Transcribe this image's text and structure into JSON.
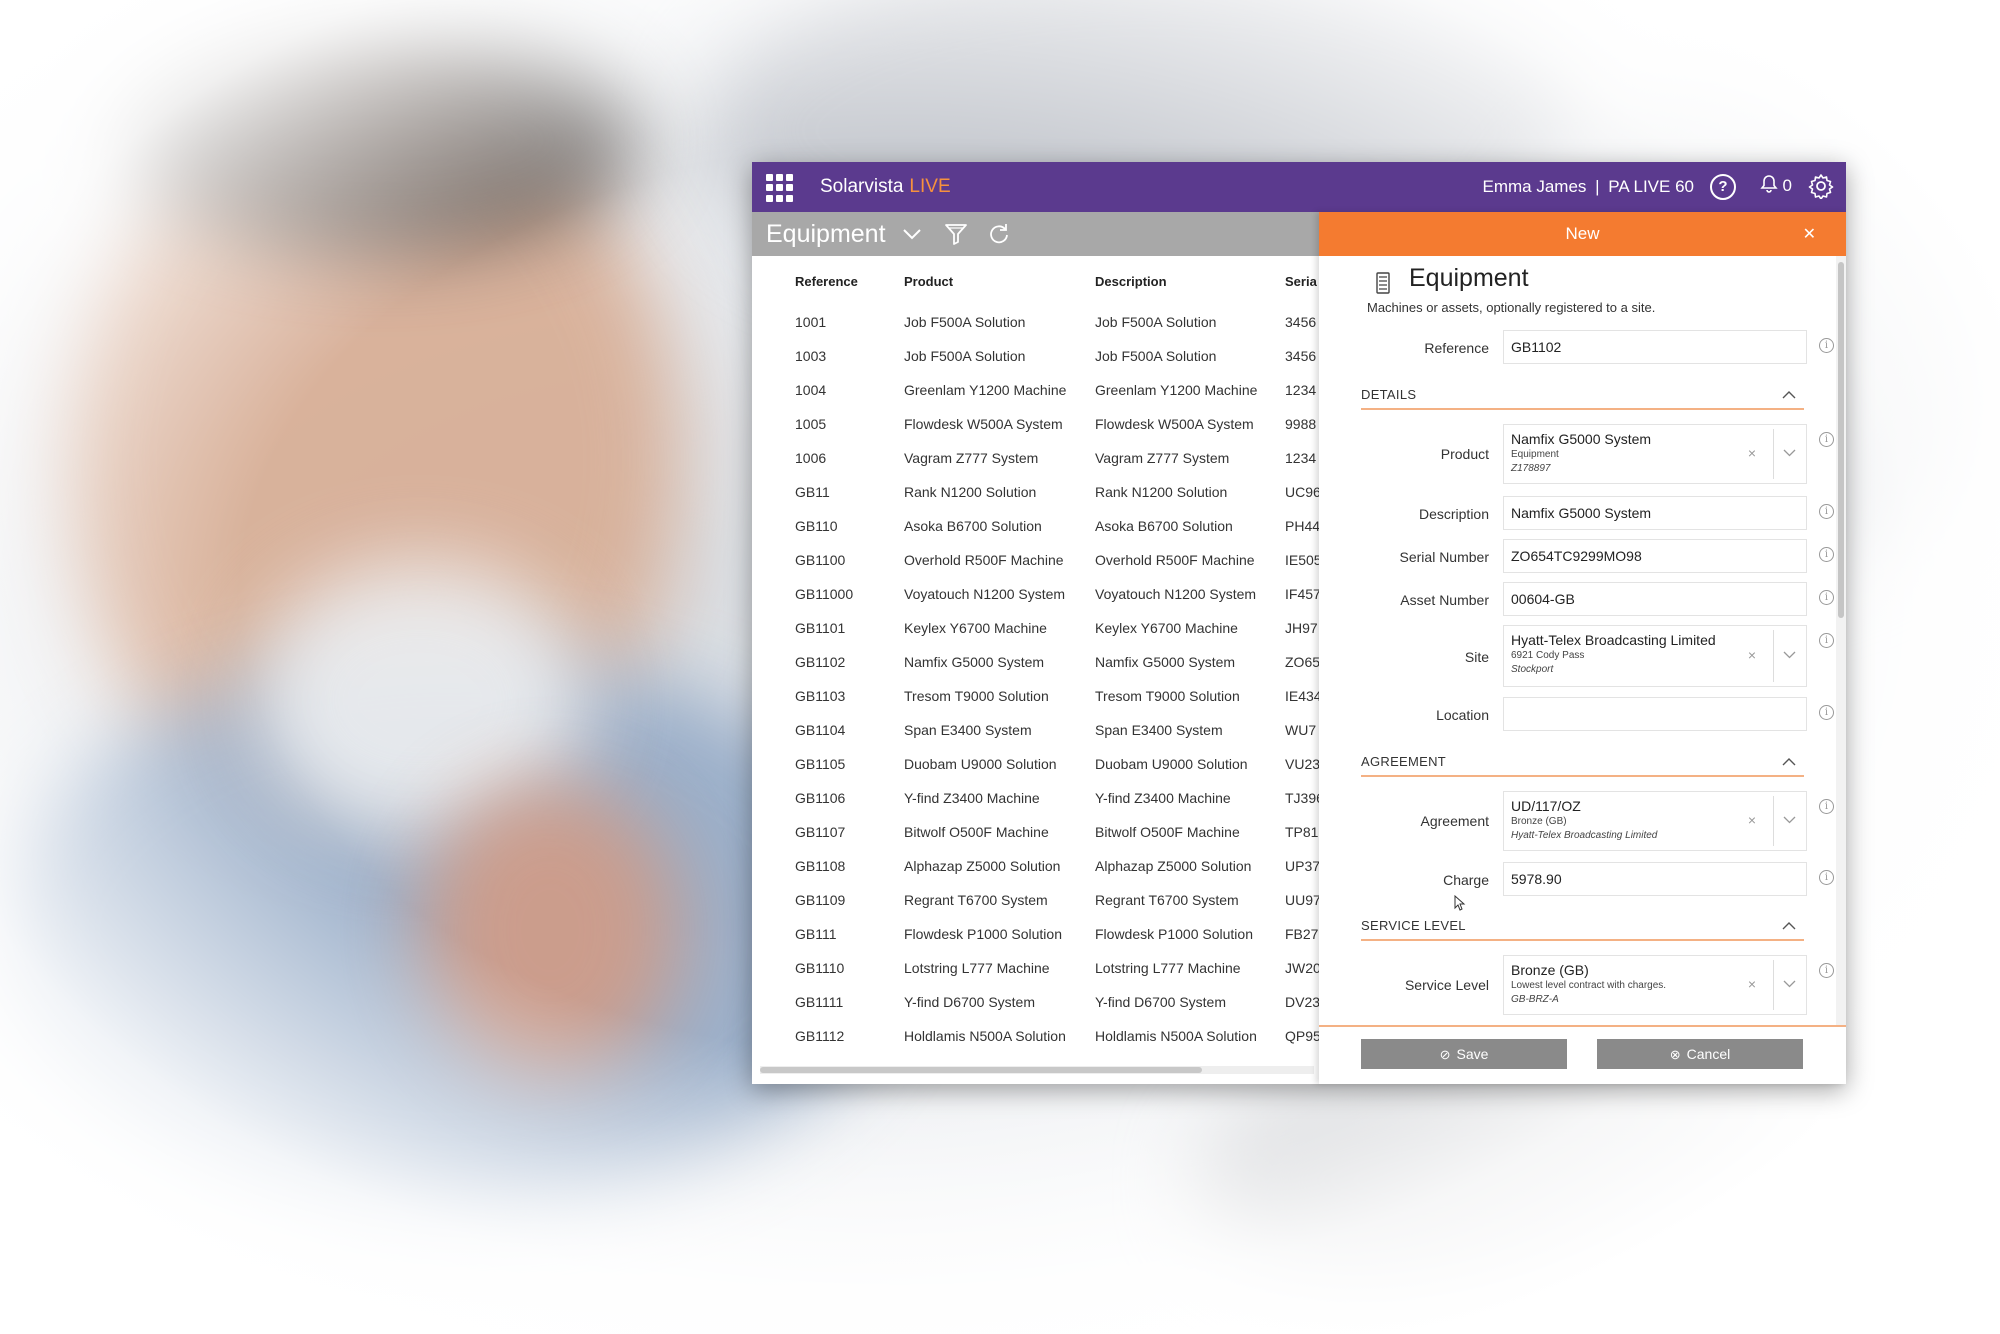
{
  "header": {
    "brand": "Solarvista",
    "brand_suffix": "LIVE",
    "user": "Emma James",
    "separator": "|",
    "environment": "PA LIVE 60",
    "notifications_count": "0"
  },
  "list": {
    "title": "Equipment",
    "columns": [
      "Reference",
      "Product",
      "Description",
      "Seria"
    ],
    "rows": [
      [
        "1001",
        "Job F500A Solution",
        "Job F500A Solution",
        "3456"
      ],
      [
        "1003",
        "Job F500A Solution",
        "Job F500A Solution",
        "3456"
      ],
      [
        "1004",
        "Greenlam Y1200 Machine",
        "Greenlam Y1200 Machine",
        "1234"
      ],
      [
        "1005",
        "Flowdesk W500A System",
        "Flowdesk W500A System",
        "9988"
      ],
      [
        "1006",
        "Vagram Z777 System",
        "Vagram Z777 System",
        "1234"
      ],
      [
        "GB11",
        "Rank N1200 Solution",
        "Rank N1200 Solution",
        "UC96"
      ],
      [
        "GB110",
        "Asoka B6700 Solution",
        "Asoka B6700 Solution",
        "PH44"
      ],
      [
        "GB1100",
        "Overhold R500F Machine",
        "Overhold R500F Machine",
        "IE505"
      ],
      [
        "GB11000",
        "Voyatouch N1200 System",
        "Voyatouch N1200 System",
        "IF457"
      ],
      [
        "GB1101",
        "Keylex Y6700 Machine",
        "Keylex Y6700 Machine",
        "JH97"
      ],
      [
        "GB1102",
        "Namfix G5000 System",
        "Namfix G5000 System",
        "ZO65"
      ],
      [
        "GB1103",
        "Tresom T9000 Solution",
        "Tresom T9000 Solution",
        "IE434"
      ],
      [
        "GB1104",
        "Span E3400 System",
        "Span E3400 System",
        "WU7"
      ],
      [
        "GB1105",
        "Duobam U9000 Solution",
        "Duobam U9000 Solution",
        "VU23"
      ],
      [
        "GB1106",
        "Y-find Z3400 Machine",
        "Y-find Z3400 Machine",
        "TJ396"
      ],
      [
        "GB1107",
        "Bitwolf O500F Machine",
        "Bitwolf O500F Machine",
        "TP81"
      ],
      [
        "GB1108",
        "Alphazap Z5000 Solution",
        "Alphazap Z5000 Solution",
        "UP37"
      ],
      [
        "GB1109",
        "Regrant T6700 System",
        "Regrant T6700 System",
        "UU97"
      ],
      [
        "GB111",
        "Flowdesk P1000 Solution",
        "Flowdesk P1000 Solution",
        "FB27"
      ],
      [
        "GB1110",
        "Lotstring L777 Machine",
        "Lotstring L777 Machine",
        "JW20"
      ],
      [
        "GB1111",
        "Y-find D6700 System",
        "Y-find D6700 System",
        "DV23"
      ],
      [
        "GB1112",
        "Holdlamis N500A Solution",
        "Holdlamis N500A Solution",
        "QP95"
      ]
    ]
  },
  "panel": {
    "header": "New",
    "title": "Equipment",
    "subtitle": "Machines or assets, optionally registered to a site.",
    "reference_label": "Reference",
    "reference_value": "GB1102",
    "details_section": "DETAILS",
    "product_label": "Product",
    "product_value": "Namfix G5000 System",
    "product_type": "Equipment",
    "product_code": "Z178897",
    "description_label": "Description",
    "description_value": "Namfix G5000 System",
    "serial_label": "Serial Number",
    "serial_value": "ZO654TC9299MO98",
    "asset_label": "Asset Number",
    "asset_value": "00604-GB",
    "site_label": "Site",
    "site_value": "Hyatt-Telex Broadcasting Limited",
    "site_address": "6921 Cody Pass",
    "site_town": "Stockport",
    "location_label": "Location",
    "location_value": "",
    "agreement_section": "AGREEMENT",
    "agreement_label": "Agreement",
    "agreement_value": "UD/117/OZ",
    "agreement_level": "Bronze (GB)",
    "agreement_customer": "Hyatt-Telex Broadcasting Limited",
    "charge_label": "Charge",
    "charge_value": "5978.90",
    "service_section": "SERVICE LEVEL",
    "service_label": "Service Level",
    "service_value": "Bronze (GB)",
    "service_desc": "Lowest level contract with charges.",
    "service_code": "GB-BRZ-A",
    "save_label": "Save",
    "cancel_label": "Cancel",
    "clear_glyph": "×",
    "info_glyph": "i"
  },
  "colors": {
    "topbar": "#5b3a8e",
    "accent": "#f47b30",
    "brand_live": "#f7913d",
    "subbar": "#a8a8a8",
    "button": "#8a8a8a"
  },
  "icons": [
    "apps-grid-icon",
    "help-icon",
    "bell-icon",
    "gear-icon",
    "chevron-down-icon",
    "filter-icon",
    "refresh-icon",
    "close-icon",
    "equipment-icon",
    "info-icon",
    "chevron-up-icon",
    "check-circle-icon",
    "cancel-circle-icon",
    "mouse-cursor-icon"
  ]
}
